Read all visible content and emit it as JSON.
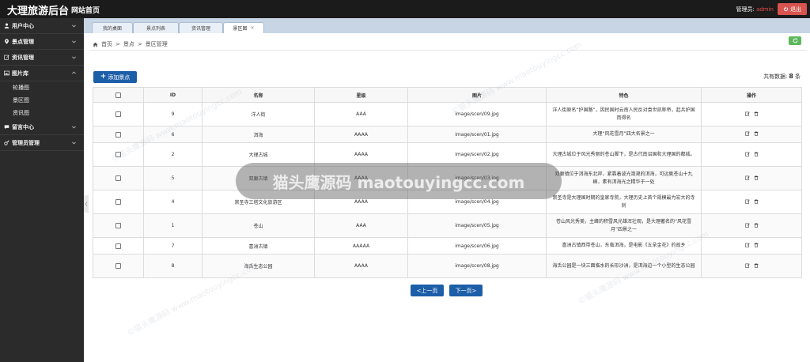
{
  "header": {
    "app_title": "大理旅游后台",
    "site_home": "网站首页",
    "admin_label": "管理员:",
    "admin_name": "admin",
    "logout_label": "退出"
  },
  "sidebar": {
    "items": [
      {
        "label": "用户中心",
        "icon": "user-icon",
        "expanded": false
      },
      {
        "label": "景点管理",
        "icon": "map-marker-icon",
        "expanded": false
      },
      {
        "label": "资讯管理",
        "icon": "edit-icon",
        "expanded": false
      },
      {
        "label": "图片库",
        "icon": "picture-icon",
        "expanded": true,
        "children": [
          "轮播图",
          "景区图",
          "资讯图"
        ]
      },
      {
        "label": "留言中心",
        "icon": "chat-icon",
        "expanded": false
      },
      {
        "label": "管理员管理",
        "icon": "admin-icon",
        "expanded": false
      }
    ]
  },
  "tabs": [
    {
      "label": "我的桌面",
      "active": false
    },
    {
      "label": "景点列表",
      "active": false
    },
    {
      "label": "资讯管理",
      "active": false
    },
    {
      "label": "景区图",
      "active": true,
      "close": "×"
    }
  ],
  "breadcrumb": {
    "home": "首页",
    "sep1": ">",
    "level1": "景点",
    "sep2": ">",
    "level2": "景区管理"
  },
  "toolbar": {
    "add_label": "添加景点",
    "count_prefix": "共有数据:",
    "count_value": "8",
    "count_suffix": "条"
  },
  "table": {
    "columns": [
      "",
      "ID",
      "名称",
      "星级",
      "图片",
      "特色",
      "操作"
    ],
    "rows": [
      {
        "id": "9",
        "name": "洋人街",
        "stars": "AAA",
        "image": "image/scen/09.jpg",
        "feature": "洋人街原名“护国路”，因民国时云南人民反对袁世凯称帝，起兵护国而得名"
      },
      {
        "id": "6",
        "name": "洱海",
        "stars": "AAAA",
        "image": "image/scen/01.jpg",
        "feature": "大理“风花雪月”四大名景之一"
      },
      {
        "id": "2",
        "name": "大理古城",
        "stars": "AAAA",
        "image": "image/scen/02.jpg",
        "feature": "大理古城位于风光秀丽的苍山脚下，是古代南诏国和大理国的都城。"
      },
      {
        "id": "5",
        "name": "双廊古镇",
        "stars": "AAAA",
        "image": "image/scen/03.jpg",
        "feature": "双廊镇位于洱海东北岸，紧靠着波光潋滟的洱海，可远眺苍山十九峰，素有洱海光之精华于一处"
      },
      {
        "id": "4",
        "name": "崇圣寺三塔文化旅游区",
        "stars": "AAAA",
        "image": "image/scen/04.jpg",
        "feature": "崇圣寺是大理国时期的皇家寺院，大理历史上首个规模最为宏大的寺刹"
      },
      {
        "id": "1",
        "name": "苍山",
        "stars": "AAA",
        "image": "image/scen/05.jpg",
        "feature": "苍山风光秀美，主峰的积雪风光雄浑壮观，是大理著名的“风花雪月”四景之一"
      },
      {
        "id": "7",
        "name": "喜洲古镇",
        "stars": "AAAAA",
        "image": "image/scen/06.jpg",
        "feature": "喜洲古镇西带苍山，东临洱海，是电影《五朵金花》的故乡"
      },
      {
        "id": "8",
        "name": "海舌生态公园",
        "stars": "AAAA",
        "image": "image/scen/08.jpg",
        "feature": "海舌公园是一块三面临水的长形沙洲，是洱海边一个小型的生态公园"
      }
    ]
  },
  "pagination": {
    "prev_label": "<上一页",
    "next_label": "下一页>"
  },
  "watermark": {
    "banner": "猫头鹰源码 maotouyingcc.com",
    "diag": "©猫头鹰源码 www.maotouyingcc.com"
  },
  "colors": {
    "topbar": "#1b1b1b",
    "sidebar": "#2b2b2b",
    "primary": "#1d5ea8",
    "danger": "#d9534f",
    "success": "#5cb85c",
    "tabs_bar": "#c7d5e5"
  }
}
